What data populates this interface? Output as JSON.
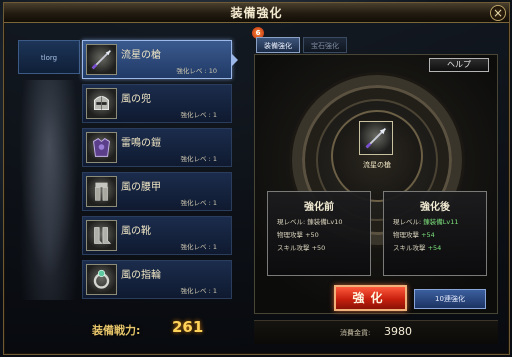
{
  "window": {
    "title": "装備強化",
    "close_label": "×"
  },
  "character": {
    "tab_label": "tlorg"
  },
  "items": [
    {
      "name": "流星の槍",
      "level": "強化レベ : 10",
      "icon": "spear-icon",
      "selected": true
    },
    {
      "name": "風の兜",
      "level": "強化レベ : 1",
      "icon": "helmet-icon",
      "selected": false
    },
    {
      "name": "雷鳴の鎧",
      "level": "強化レベ : 1",
      "icon": "armor-icon",
      "selected": false
    },
    {
      "name": "風の腰甲",
      "level": "強化レベ : 1",
      "icon": "leg-armor-icon",
      "selected": false
    },
    {
      "name": "風の靴",
      "level": "強化レベ : 1",
      "icon": "boots-icon",
      "selected": false
    },
    {
      "name": "風の指輪",
      "level": "強化レベ : 1",
      "icon": "ring-icon",
      "selected": false
    }
  ],
  "combat_power": {
    "label": "装備戦力:",
    "value": "261"
  },
  "tabs": {
    "badge": "6",
    "enhance": "装備強化",
    "gem": "宝石強化"
  },
  "panel": {
    "help": "ヘルプ",
    "center_item_name": "流星の槍",
    "before": {
      "title": "強化前",
      "lines": [
        {
          "label": "現レベル:",
          "value": "錬装備Lv10"
        },
        {
          "label": "物理攻撃",
          "value": "+50"
        },
        {
          "label": "スキル攻撃",
          "value": "+50"
        }
      ]
    },
    "after": {
      "title": "強化後",
      "lines": [
        {
          "label": "現レベル:",
          "value": "錬装備Lv11"
        },
        {
          "label": "物理攻撃",
          "value": "+54"
        },
        {
          "label": "スキル攻撃",
          "value": "+54"
        }
      ]
    },
    "enhance_button": "強化",
    "multi_button": "10連強化",
    "cost_label": "消費金貨:",
    "cost_value": "3980"
  },
  "colors": {
    "accent_gold": "#e7c56a",
    "enhance_red": "#c8200e",
    "stat_green": "#7be07b"
  }
}
